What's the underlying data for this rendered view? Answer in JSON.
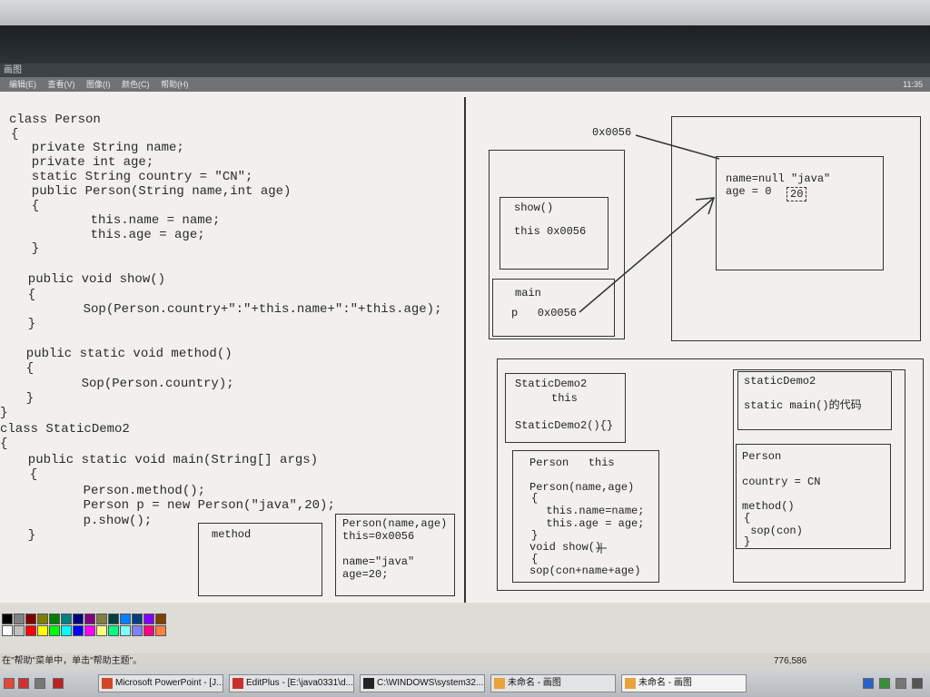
{
  "window": {
    "title": "画图",
    "menus": [
      "编辑(E)",
      "查看(V)",
      "图像(I)",
      "颜色(C)",
      "帮助(H)"
    ],
    "menu_right": "11:35"
  },
  "code": {
    "lines": [
      "class Person",
      "{",
      "  private String name;",
      "  private int age;",
      "  static String country = \"CN\";",
      "  public Person(String name,int age)",
      "  {",
      "         this.name = name;",
      "         this.age = age;",
      "  }",
      "  public void show()",
      "  {",
      "         Sop(Person.country+\":\"+this.name+\":\"+this.age);",
      "  }",
      "  public static void method()",
      "  {",
      "         Sop(Person.country);",
      "  }",
      "}",
      "class StaticDemo2",
      "{",
      "  public static void main(String[] args)",
      "  {",
      "         Person.method();",
      "         Person p = new Person(\"java\",20);",
      "         p.show();",
      "  }"
    ]
  },
  "method_box": {
    "label": "method"
  },
  "person_ctor_box": {
    "lines": [
      "Person(name,age)",
      "this=0x0056",
      "",
      "name=\"java\"",
      "age=20;"
    ]
  },
  "heap_address": "0x0056",
  "heap_object": {
    "line1": "name=null \"java\"",
    "line2": "age = 0",
    "age_value": "20"
  },
  "stack": {
    "show_frame": {
      "title": "show()",
      "this_line": "this 0x0056"
    },
    "main_frame": {
      "title": "main",
      "p_line": "p   0x0056"
    }
  },
  "method_area": {
    "staticdemo2_box": {
      "lines": [
        "StaticDemo2",
        "this",
        "",
        "StaticDemo2(){}"
      ]
    },
    "person_box": {
      "lines": [
        "Person   this",
        "",
        "Person(name,age)",
        "{",
        "  this.name=name;",
        "  this.age = age;",
        "}",
        "void show()",
        "{",
        "sop(con+name+age)"
      ]
    },
    "static_box": {
      "lines": [
        "staticDemo2",
        "",
        "static main()的代码"
      ]
    },
    "person_static_box": {
      "lines": [
        "Person",
        "",
        "country = CN",
        "",
        "method()",
        "{",
        " sop(con)",
        "}"
      ]
    }
  },
  "status": {
    "text": "在\"帮助\"菜单中，单击\"帮助主题\"。",
    "coords": "776,586"
  },
  "taskbar": {
    "items": [
      "Microsoft PowerPoint - [J...",
      "EditPlus - [E:\\java0331\\d...",
      "C:\\WINDOWS\\system32...",
      "未命名 - 画图",
      "未命名 - 画图"
    ]
  },
  "colors": {
    "canvas_bg": "#f1f0ec",
    "ink": "#2a2a2a",
    "palette": [
      "#000000",
      "#808080",
      "#800000",
      "#808000",
      "#008000",
      "#008080",
      "#000080",
      "#800080",
      "#808040",
      "#004040",
      "#0080ff",
      "#004080",
      "#8000ff",
      "#804000",
      "#ffffff",
      "#c0c0c0",
      "#ff0000",
      "#ffff00",
      "#00ff00",
      "#00ffff",
      "#0000ff",
      "#ff00ff",
      "#ffff80",
      "#00ff80",
      "#80ffff",
      "#8080ff",
      "#ff0080",
      "#ff8040"
    ]
  }
}
